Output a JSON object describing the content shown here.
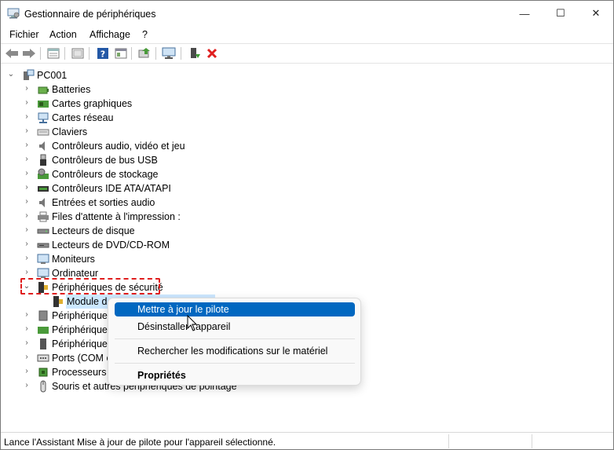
{
  "window": {
    "title": "Gestionnaire de périphériques",
    "controls": {
      "minimize": "—",
      "maximize": "☐",
      "close": "✕"
    }
  },
  "menu": [
    "Fichier",
    "Action",
    "Affichage",
    "?"
  ],
  "toolbar": {
    "buttons": [
      "back-arrow-icon",
      "forward-arrow-icon",
      "properties-icon",
      "show-hide-icon",
      "help-icon",
      "view-icon",
      "update-driver-icon",
      "scan-hardware-icon",
      "enable-device-icon",
      "uninstall-icon"
    ]
  },
  "tree": {
    "root": "PC001",
    "categories": [
      "Batteries",
      "Cartes graphiques",
      "Cartes réseau",
      "Claviers",
      "Contrôleurs audio, vidéo et jeu",
      "Contrôleurs de bus USB",
      "Contrôleurs de stockage",
      "Contrôleurs IDE ATA/ATAPI",
      "Entrées et sorties audio",
      "Files d'attente à l'impression :",
      "Lecteurs de disque",
      "Lecteurs de DVD/CD-ROM",
      "Moniteurs",
      "Ordinateur",
      "Périphériques de sécurité"
    ],
    "expanded_child": "Module d",
    "after": [
      "Périphériques",
      "Périphériques",
      "Périphériques",
      "Ports (COM e",
      "Processeurs",
      "Souris et autres périphériques de pointage"
    ]
  },
  "context_menu": {
    "update": "Mettre à jour le pilote",
    "uninstall": "Désinstaller l'appareil",
    "scan": "Rechercher les modifications sur le matériel",
    "properties": "Propriétés"
  },
  "status": "Lance l'Assistant Mise à jour de pilote pour l'appareil sélectionné.",
  "colors": {
    "accent": "#0067c0",
    "selection": "#cce8ff",
    "highlight_dash": "#e01e1e"
  }
}
